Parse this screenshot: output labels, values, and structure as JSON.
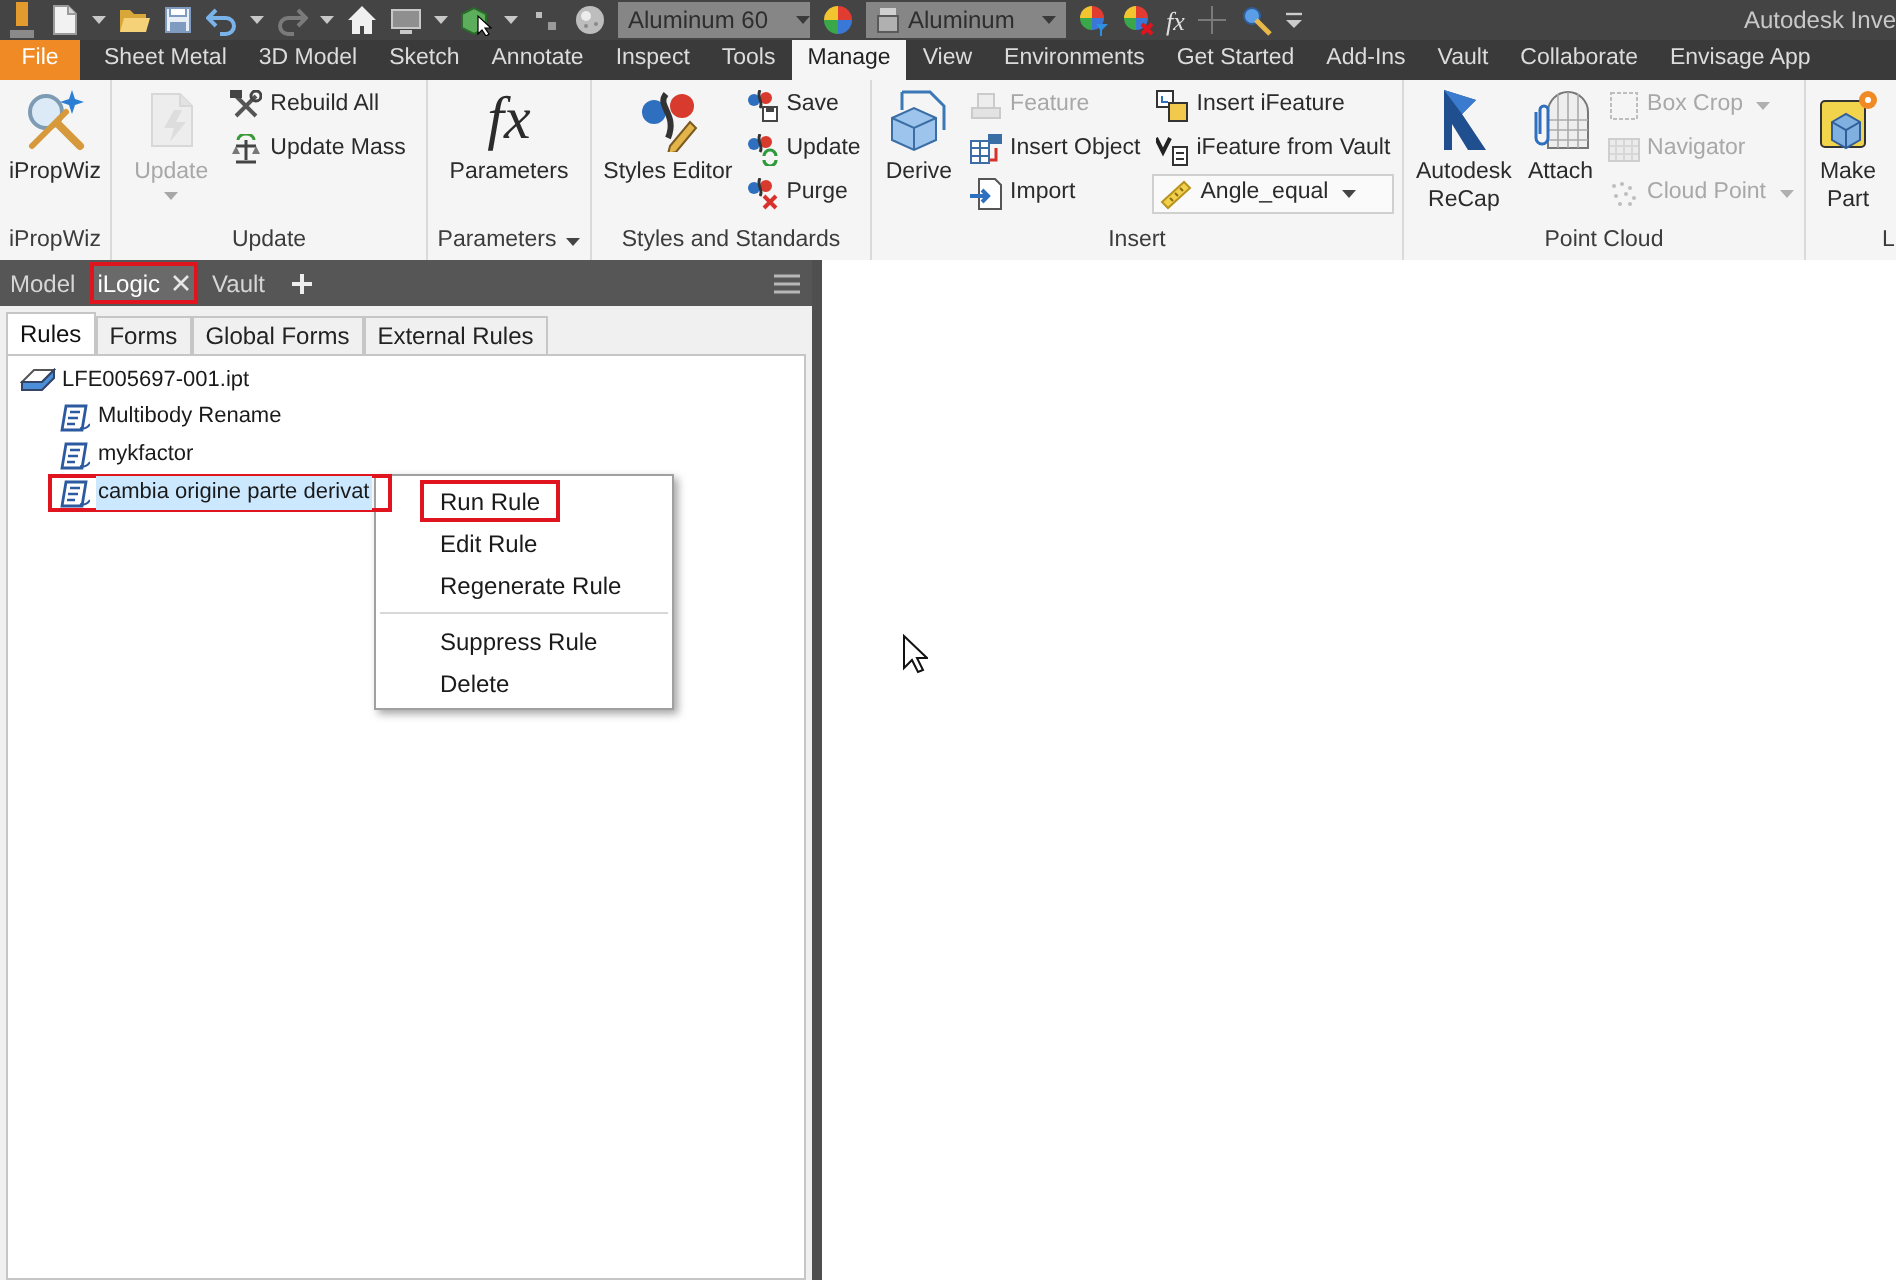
{
  "window": {
    "title": "Autodesk Inve"
  },
  "quick_access_toolbar": {
    "material": "Aluminum 60",
    "appearance": "Aluminum",
    "formula_glyph": "fx"
  },
  "ribbon": {
    "tabs": [
      {
        "label": "File",
        "kind": "application_menu",
        "selected": false
      },
      {
        "label": "Sheet Metal",
        "kind": "tab",
        "selected": false
      },
      {
        "label": "3D Model",
        "kind": "tab",
        "selected": false
      },
      {
        "label": "Sketch",
        "kind": "tab",
        "selected": false
      },
      {
        "label": "Annotate",
        "kind": "tab",
        "selected": false
      },
      {
        "label": "Inspect",
        "kind": "tab",
        "selected": false
      },
      {
        "label": "Tools",
        "kind": "tab",
        "selected": false
      },
      {
        "label": "Manage",
        "kind": "tab",
        "selected": true
      },
      {
        "label": "View",
        "kind": "tab",
        "selected": false
      },
      {
        "label": "Environments",
        "kind": "tab",
        "selected": false
      },
      {
        "label": "Get Started",
        "kind": "tab",
        "selected": false
      },
      {
        "label": "Add-Ins",
        "kind": "tab",
        "selected": false
      },
      {
        "label": "Vault",
        "kind": "tab",
        "selected": false
      },
      {
        "label": "Collaborate",
        "kind": "tab",
        "selected": false
      },
      {
        "label": "Envisage App",
        "kind": "tab",
        "selected": false
      }
    ],
    "panels": [
      {
        "label": "iPropWiz",
        "dropdown": false,
        "columns": [
          {
            "kind": "large",
            "buttons": [
              {
                "label": "iPropWiz",
                "disabled": false,
                "dropdown": false
              }
            ]
          }
        ]
      },
      {
        "label": "Update",
        "dropdown": false,
        "columns": [
          {
            "kind": "large",
            "buttons": [
              {
                "label": "Update",
                "disabled": true,
                "dropdown": true
              }
            ]
          },
          {
            "kind": "small",
            "buttons": [
              {
                "label": "Rebuild All",
                "disabled": false,
                "dropdown": false
              },
              {
                "label": "Update Mass",
                "disabled": false,
                "dropdown": false
              }
            ]
          }
        ]
      },
      {
        "label": "Parameters",
        "dropdown": true,
        "columns": [
          {
            "kind": "large",
            "buttons": [
              {
                "label": "Parameters",
                "glyph": "fx",
                "disabled": false,
                "dropdown": false
              }
            ]
          }
        ]
      },
      {
        "label": "Styles and Standards",
        "dropdown": false,
        "columns": [
          {
            "kind": "large",
            "buttons": [
              {
                "label": "Styles Editor",
                "disabled": false,
                "dropdown": false,
                "wrap": false
              }
            ]
          },
          {
            "kind": "small",
            "buttons": [
              {
                "label": "Save",
                "disabled": false,
                "dropdown": false
              },
              {
                "label": "Update",
                "disabled": false,
                "dropdown": false
              },
              {
                "label": "Purge",
                "disabled": false,
                "dropdown": false
              }
            ]
          }
        ]
      },
      {
        "label": "Insert",
        "dropdown": false,
        "columns": [
          {
            "kind": "large",
            "buttons": [
              {
                "label": "Derive",
                "disabled": false,
                "dropdown": false
              }
            ]
          },
          {
            "kind": "small",
            "buttons": [
              {
                "label": "Feature",
                "disabled": true,
                "dropdown": false
              },
              {
                "label": "Insert Object",
                "disabled": false,
                "dropdown": false
              },
              {
                "label": "Import",
                "disabled": false,
                "dropdown": false
              }
            ]
          },
          {
            "kind": "small",
            "buttons": [
              {
                "kind": "button",
                "label": "Insert iFeature",
                "disabled": false,
                "dropdown": false
              },
              {
                "kind": "button",
                "label": "iFeature from Vault",
                "disabled": false,
                "dropdown": false
              },
              {
                "kind": "combo",
                "label": "Angle_equal",
                "disabled": false,
                "dropdown": true
              }
            ]
          }
        ]
      },
      {
        "label": "Point Cloud",
        "dropdown": false,
        "columns": [
          {
            "kind": "large",
            "buttons": [
              {
                "label": "Autodesk ReCap",
                "disabled": false,
                "dropdown": false,
                "wrap": true
              }
            ]
          },
          {
            "kind": "large",
            "buttons": [
              {
                "label": "Attach",
                "disabled": false,
                "dropdown": false
              }
            ]
          },
          {
            "kind": "small",
            "buttons": [
              {
                "label": "Box Crop",
                "disabled": true,
                "dropdown": true
              },
              {
                "label": "Navigator",
                "disabled": true,
                "dropdown": false
              },
              {
                "label": "Cloud Point",
                "disabled": true,
                "dropdown": true
              }
            ]
          }
        ]
      },
      {
        "label": "L",
        "dropdown": false,
        "columns": [
          {
            "kind": "large",
            "buttons": [
              {
                "label": "Make Part",
                "disabled": false,
                "dropdown": false,
                "wrap": true
              }
            ]
          }
        ]
      }
    ]
  },
  "browser": {
    "tabs": [
      {
        "label": "Model",
        "selected": false,
        "marked": false,
        "closable": false
      },
      {
        "label": "iLogic",
        "selected": true,
        "marked": true,
        "closable": true
      },
      {
        "label": "Vault",
        "selected": false,
        "marked": false,
        "closable": false
      }
    ]
  },
  "ilogic_panel": {
    "tabs": [
      {
        "label": "Rules",
        "selected": true
      },
      {
        "label": "Forms",
        "selected": false
      },
      {
        "label": "Global Forms",
        "selected": false
      },
      {
        "label": "External Rules",
        "selected": false
      }
    ],
    "rules_tree": {
      "label": "LFE005697-001.ipt",
      "children": [
        {
          "label": "Multibody Rename",
          "selected": false,
          "marked": false
        },
        {
          "label": "mykfactor",
          "selected": false,
          "marked": false
        },
        {
          "label": "cambia origine parte derivat",
          "selected": true,
          "marked": true
        }
      ]
    }
  },
  "context_menu": {
    "sections": [
      {
        "items": [
          {
            "label": "Run Rule",
            "marked": true
          },
          {
            "label": "Edit Rule",
            "marked": false
          },
          {
            "label": "Regenerate Rule",
            "marked": false
          }
        ]
      },
      {
        "items": [
          {
            "label": "Suppress Rule",
            "marked": false
          },
          {
            "label": "Delete",
            "marked": false
          }
        ]
      }
    ]
  }
}
